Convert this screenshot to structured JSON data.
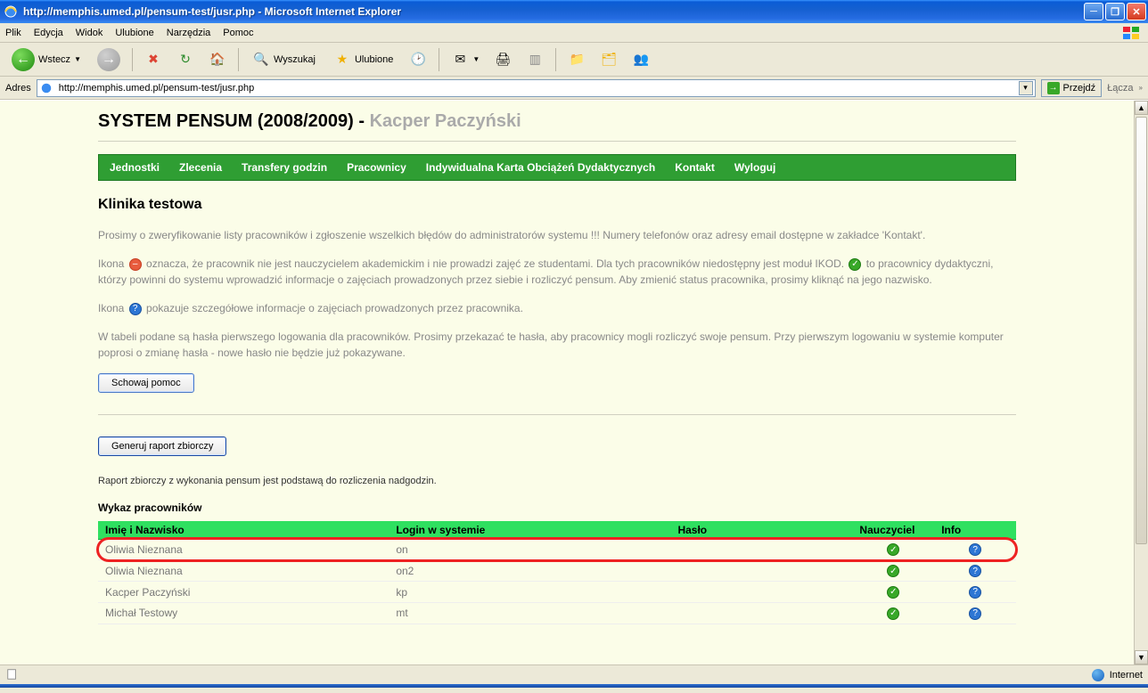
{
  "window": {
    "title": "http://memphis.umed.pl/pensum-test/jusr.php - Microsoft Internet Explorer"
  },
  "menu": {
    "plik": "Plik",
    "edycja": "Edycja",
    "widok": "Widok",
    "ulubione": "Ulubione",
    "narzedzia": "Narzędzia",
    "pomoc": "Pomoc"
  },
  "toolbar": {
    "back": "Wstecz",
    "search": "Wyszukaj",
    "favorites": "Ulubione"
  },
  "address": {
    "label": "Adres",
    "url": "http://memphis.umed.pl/pensum-test/jusr.php",
    "go": "Przejdź",
    "links": "Łącza"
  },
  "page": {
    "system_title": "SYSTEM PENSUM (2008/2009) - ",
    "user": "Kacper Paczyński",
    "nav": {
      "jednostki": "Jednostki",
      "zlecenia": "Zlecenia",
      "transfery": "Transfery godzin",
      "pracownicy": "Pracownicy",
      "ikod": "Indywidualna Karta Obciążeń Dydaktycznych",
      "kontakt": "Kontakt",
      "wyloguj": "Wyloguj"
    },
    "section_title": "Klinika testowa",
    "p1": "Prosimy o zweryfikowanie listy pracowników i zgłoszenie wszelkich błędów do administratorów systemu !!! Numery telefonów oraz adresy email dostępne w zakładce 'Kontakt'.",
    "p2a": "Ikona ",
    "p2b": " oznacza, że pracownik nie jest nauczycielem akademickim i nie prowadzi zajęć ze studentami. Dla tych pracowników niedostępny jest moduł IKOD. ",
    "p2c": " to pracownicy dydaktyczni, którzy powinni do systemu wprowadzić informacje o zajęciach prowadzonych przez siebie i rozliczyć pensum. Aby zmienić status pracownika, prosimy kliknąć na jego nazwisko.",
    "p3a": "Ikona ",
    "p3b": " pokazuje szczegółowe informacje o zajęciach prowadzonych przez pracownika.",
    "p4": "W tabeli podane są hasła pierwszego logowania dla pracowników. Prosimy przekazać te hasła, aby pracownicy mogli rozliczyć swoje pensum. Przy pierwszym logowaniu w systemie komputer poprosi o zmianę hasła - nowe hasło nie będzie już pokazywane.",
    "hide_help": "Schowaj pomoc",
    "gen_report": "Generuj raport zbiorczy",
    "report_note": "Raport zbiorczy z wykonania pensum jest podstawą do rozliczenia nadgodzin.",
    "table_title": "Wykaz pracowników",
    "th": {
      "name": "Imię i Nazwisko",
      "login": "Login w systemie",
      "pass": "Hasło",
      "teacher": "Nauczyciel",
      "info": "Info"
    },
    "rows": [
      {
        "name": "Oliwia Nieznana",
        "login": "on",
        "pass": "",
        "teacher": true,
        "hl": true
      },
      {
        "name": "Oliwia Nieznana",
        "login": "on2",
        "pass": "",
        "teacher": true,
        "hl": false
      },
      {
        "name": "Kacper Paczyński",
        "login": "kp",
        "pass": "",
        "teacher": true,
        "hl": false
      },
      {
        "name": "Michał Testowy",
        "login": "mt",
        "pass": "",
        "teacher": true,
        "hl": false
      }
    ]
  },
  "status": {
    "zone": "Internet"
  }
}
